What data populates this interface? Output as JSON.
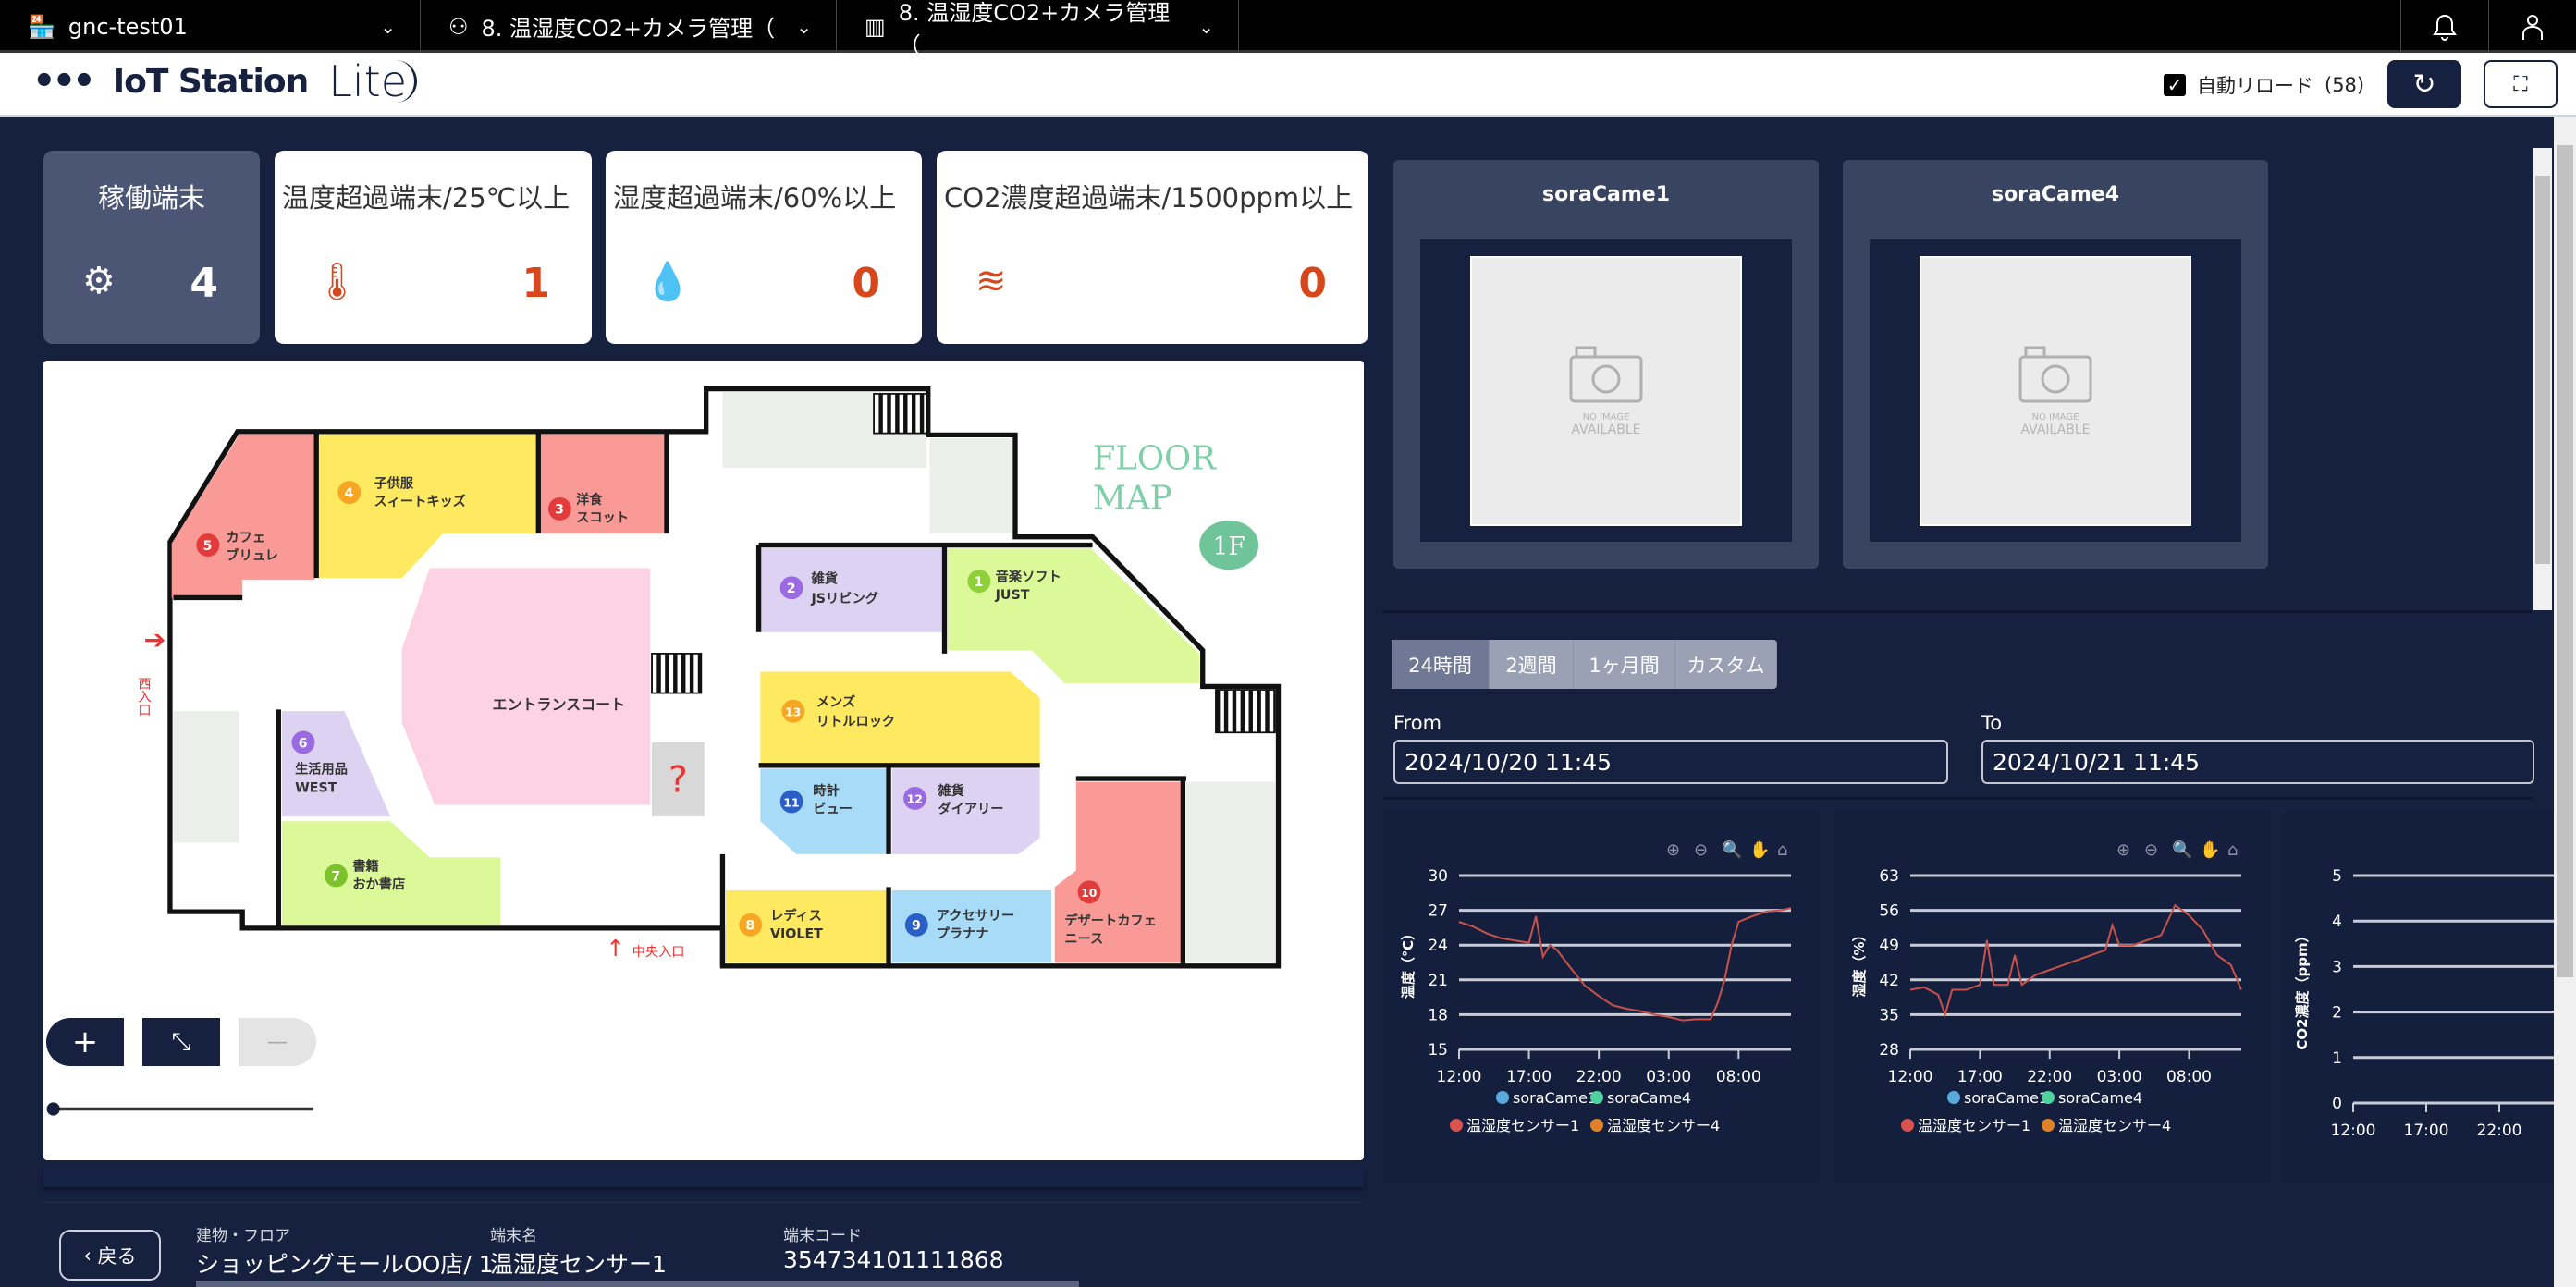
{
  "topbar": {
    "tabs": [
      {
        "label": "gnc-test01",
        "icon": "store-icon"
      },
      {
        "label": "8. 温湿度CO2+カメラ管理（",
        "icon": "network-icon"
      },
      {
        "label": "8. 温湿度CO2+カメラ管理（",
        "icon": "bar-chart-icon"
      }
    ],
    "icons": [
      "bell-icon",
      "user-icon"
    ]
  },
  "header": {
    "logo_text": "IoT Station",
    "logo_suffix": "Lite",
    "auto_reload_label": "自動リロード",
    "auto_reload_count": "(58)",
    "auto_reload_checked": true
  },
  "stats": [
    {
      "title": "稼働端末",
      "value": "4",
      "icon": "gear-icon"
    },
    {
      "title": "温度超過端末/25℃以上",
      "value": "1",
      "icon": "thermometer-icon"
    },
    {
      "title": "湿度超過端末/60%以上",
      "value": "0",
      "icon": "water-drop-icon"
    },
    {
      "title": "CO2濃度超過端末/1500ppm以上",
      "value": "0",
      "icon": "wind-icon"
    }
  ],
  "floormap": {
    "title1": "FLOOR",
    "title2": "MAP",
    "floor": "1F",
    "court": "エントランスコート",
    "west_entrance": "西入口",
    "center_entrance": "中央入口",
    "shops": [
      {
        "no": "1",
        "l1": "音楽ソフト",
        "l2": "JUST"
      },
      {
        "no": "2",
        "l1": "雑貨",
        "l2": "JSリビング"
      },
      {
        "no": "3",
        "l1": "洋食",
        "l2": "スコット"
      },
      {
        "no": "4",
        "l1": "子供服",
        "l2": "スィートキッズ"
      },
      {
        "no": "5",
        "l1": "カフェ",
        "l2": "ブリュレ"
      },
      {
        "no": "6",
        "l1": "生活用品",
        "l2": "WEST"
      },
      {
        "no": "7",
        "l1": "書籍",
        "l2": "おか書店"
      },
      {
        "no": "8",
        "l1": "レディス",
        "l2": "VIOLET"
      },
      {
        "no": "9",
        "l1": "アクセサリー",
        "l2": "プラナナ"
      },
      {
        "no": "10",
        "l1": "デザートカフェ",
        "l2": "ニース"
      },
      {
        "no": "11",
        "l1": "時計",
        "l2": "ビュー"
      },
      {
        "no": "12",
        "l1": "雑貨",
        "l2": "ダイアリー"
      },
      {
        "no": "13",
        "l1": "メンズ",
        "l2": "リトルロック"
      }
    ],
    "zoom_slider_value": 0
  },
  "map_controls": {
    "zoom_in": "+",
    "fit": "⤡",
    "zoom_out": "—"
  },
  "info": {
    "back_label": "戻る",
    "building_label": "建物・フロア",
    "building_value": "ショッピングモールOO店/ 1",
    "device_label": "端末名",
    "device_value": "温湿度センサー1",
    "code_label": "端末コード",
    "code_value": "354734101111868"
  },
  "cameras": [
    {
      "name": "soraCame1",
      "placeholder1": "NO IMAGE",
      "placeholder2": "AVAILABLE"
    },
    {
      "name": "soraCame4",
      "placeholder1": "NO IMAGE",
      "placeholder2": "AVAILABLE"
    }
  ],
  "range_tabs": [
    {
      "label": "24時間",
      "active": true
    },
    {
      "label": "2週間",
      "active": false
    },
    {
      "label": "1ヶ月間",
      "active": false
    },
    {
      "label": "カスタム",
      "active": false
    }
  ],
  "date_range": {
    "from_label": "From",
    "from_value": "2024/10/20 11:45",
    "to_label": "To",
    "to_value": "2024/10/21 11:45"
  },
  "colors": {
    "navy": "#16213f",
    "alert": "#d8461c",
    "line": "#c9524a",
    "soraCame1": "#5aa9dd",
    "soraCame4": "#4fd1a0",
    "sensor1": "#d9534f",
    "sensor4": "#e0822a"
  },
  "chart_data": [
    {
      "type": "line",
      "ylabel": "温度（℃）",
      "ylim": [
        15,
        30
      ],
      "yticks": [
        "15",
        "18",
        "21",
        "24",
        "27",
        "30"
      ],
      "xticks": [
        "12:00",
        "17:00",
        "22:00",
        "03:00",
        "08:00"
      ],
      "grid": true,
      "legend": [
        "soraCame1",
        "soraCame4",
        "温湿度センサー1",
        "温湿度センサー4"
      ],
      "legend_placement": "bottom",
      "series": [
        {
          "name": "温湿度センサー1",
          "x": [
            "10/20 12:00",
            "10/20 13:00",
            "10/20 14:00",
            "10/20 15:00",
            "10/20 16:00",
            "10/20 17:00",
            "10/20 17:30",
            "10/20 18:00",
            "10/20 18:30",
            "10/20 19:00",
            "10/20 20:00",
            "10/20 21:00",
            "10/20 22:00",
            "10/20 23:00",
            "10/21 00:00",
            "10/21 01:00",
            "10/21 02:00",
            "10/21 03:00",
            "10/21 04:00",
            "10/21 05:00",
            "10/21 06:00",
            "10/21 06:30",
            "10/21 07:00",
            "10/21 07:30",
            "10/21 08:00",
            "10/21 09:00",
            "10/21 10:00",
            "10/21 11:00",
            "10/21 11:45"
          ],
          "y": [
            26,
            25.6,
            25,
            24.6,
            24.4,
            24.2,
            26.5,
            23,
            24,
            23.6,
            22,
            20.5,
            19.6,
            18.8,
            18.5,
            18.3,
            18,
            17.8,
            17.5,
            17.6,
            17.6,
            19,
            21,
            24,
            26,
            26.5,
            26.9,
            27,
            27.2
          ]
        }
      ]
    },
    {
      "type": "line",
      "ylabel": "湿度（%）",
      "ylim": [
        28,
        63
      ],
      "yticks": [
        "28",
        "35",
        "42",
        "49",
        "56",
        "63"
      ],
      "xticks": [
        "12:00",
        "17:00",
        "22:00",
        "03:00",
        "08:00"
      ],
      "grid": true,
      "legend": [
        "soraCame1",
        "soraCame4",
        "温湿度センサー1",
        "温湿度センサー4"
      ],
      "legend_placement": "bottom",
      "series": [
        {
          "name": "温湿度センサー1",
          "x": [
            "10/20 12:00",
            "10/20 13:00",
            "10/20 14:00",
            "10/20 14:30",
            "10/20 15:00",
            "10/20 16:00",
            "10/20 17:00",
            "10/20 17:30",
            "10/20 18:00",
            "10/20 19:00",
            "10/20 19:30",
            "10/20 20:00",
            "10/20 21:00",
            "10/20 22:00",
            "10/20 23:00",
            "10/21 00:00",
            "10/21 01:00",
            "10/21 02:00",
            "10/21 02:30",
            "10/21 03:00",
            "10/21 04:00",
            "10/21 05:00",
            "10/21 06:00",
            "10/21 07:00",
            "10/21 08:00",
            "10/21 09:00",
            "10/21 10:00",
            "10/21 11:00",
            "10/21 11:45"
          ],
          "y": [
            40,
            40.5,
            39,
            35,
            40,
            40,
            41,
            50,
            41,
            41,
            47,
            41,
            43,
            44,
            45,
            46,
            47,
            48,
            53,
            49,
            49,
            50,
            51,
            57,
            55,
            52,
            47,
            45,
            40
          ]
        }
      ]
    },
    {
      "type": "line",
      "ylabel": "CO2濃度（ppm）",
      "ylim": [
        0,
        5
      ],
      "yticks": [
        "0",
        "1",
        "2",
        "3",
        "4",
        "5"
      ],
      "xticks": [
        "12:00",
        "17:00",
        "22:00"
      ],
      "grid": true,
      "series": []
    }
  ]
}
